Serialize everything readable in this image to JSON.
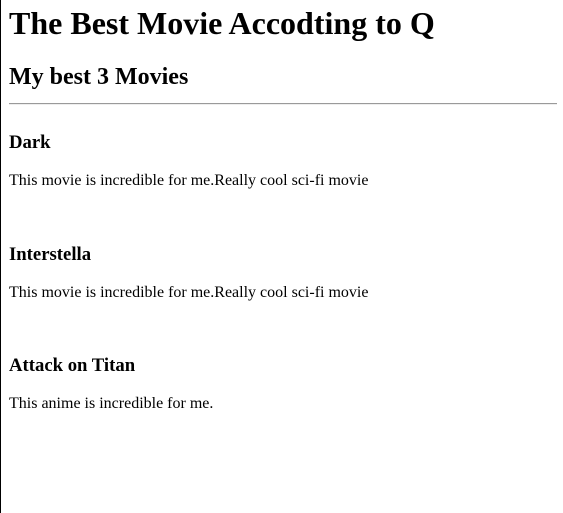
{
  "page": {
    "title": "The Best Movie Accodting to Q",
    "subtitle": "My best 3 Movies"
  },
  "movies": [
    {
      "name": "Dark",
      "description": "This movie is incredible for me.Really cool sci-fi movie"
    },
    {
      "name": "Interstella",
      "description": "This movie is incredible for me.Really cool sci-fi movie"
    },
    {
      "name": "Attack on Titan",
      "description": "This anime is incredible for me."
    }
  ]
}
